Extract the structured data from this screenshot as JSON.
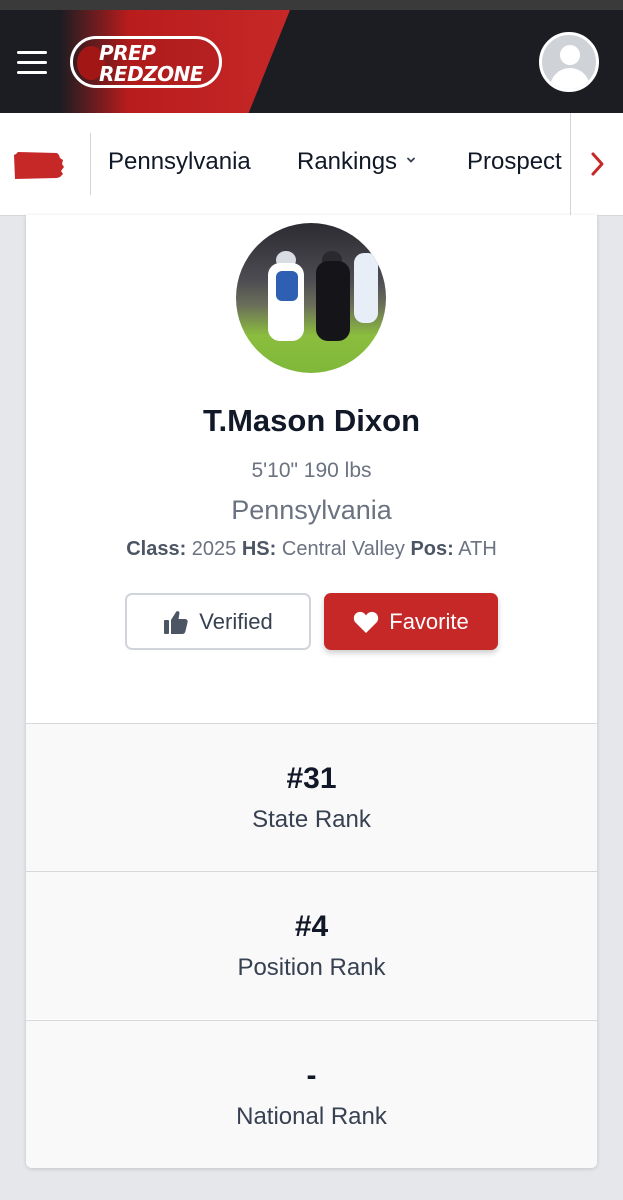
{
  "header": {
    "logo_line1": "PREP",
    "logo_line2": "REDZONE"
  },
  "nav": {
    "state_icon": "pennsylvania-map-icon",
    "items": [
      "Pennsylvania",
      "Rankings",
      "Prospect"
    ],
    "more_icon": "chevron-right-icon"
  },
  "player": {
    "name": "T.Mason Dixon",
    "height_weight": "5'10\" 190 lbs",
    "state": "Pennsylvania",
    "class_label": "Class:",
    "class_value": "2025",
    "hs_label": "HS:",
    "hs_value": "Central Valley",
    "pos_label": "Pos:",
    "pos_value": "ATH"
  },
  "actions": {
    "verified_label": "Verified",
    "favorite_label": "Favorite"
  },
  "ranks": [
    {
      "value": "#31",
      "label": "State Rank"
    },
    {
      "value": "#4",
      "label": "Position Rank"
    },
    {
      "value": "-",
      "label": "National Rank"
    }
  ],
  "colors": {
    "brand_red": "#c62828",
    "header_dark": "#1c1d22"
  }
}
